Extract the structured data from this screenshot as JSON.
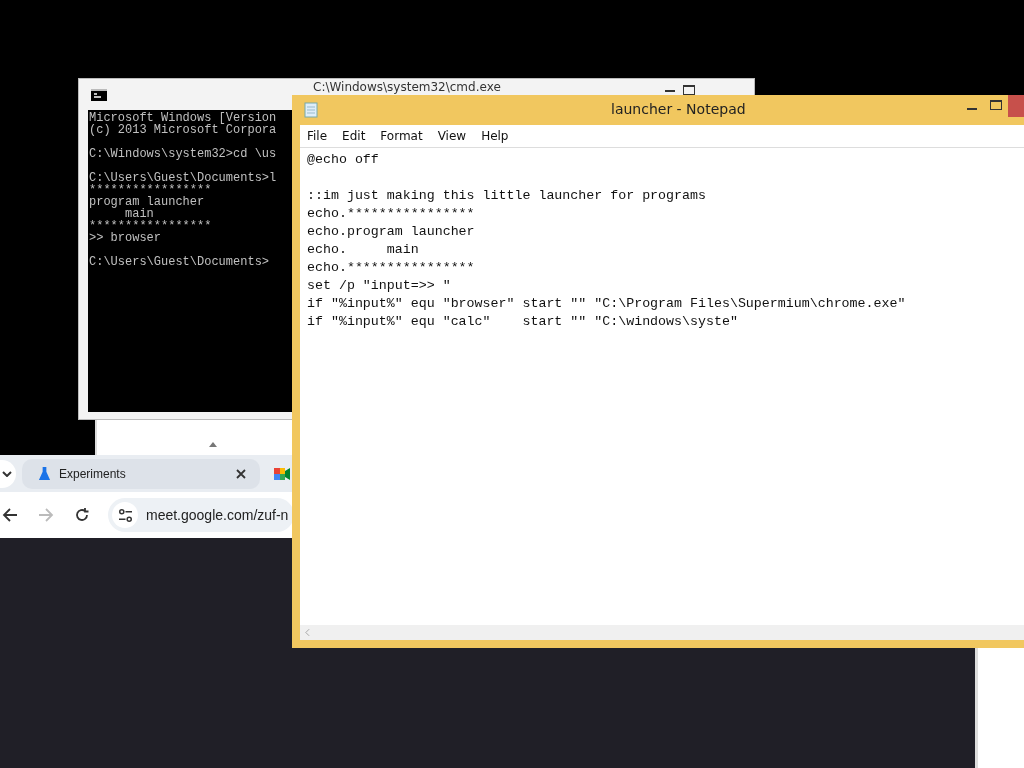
{
  "cmd_window": {
    "title": "C:\\Windows\\system32\\cmd.exe",
    "blocks": [
      [
        "Microsoft Windows [Version",
        "(c) 2013 Microsoft Corpora"
      ],
      [
        "C:\\Windows\\system32>cd \\us"
      ],
      [
        "C:\\Users\\Guest\\Documents>l",
        "*****************",
        "program launcher",
        "     main",
        "*****************",
        ">> browser"
      ],
      [
        "C:\\Users\\Guest\\Documents>"
      ]
    ]
  },
  "browser": {
    "tabs": [
      {
        "title": "Experiments"
      }
    ],
    "nav": [
      {
        "kind": "back",
        "disabled": false
      },
      {
        "kind": "forward",
        "disabled": true
      },
      {
        "kind": "reload",
        "disabled": false
      }
    ],
    "address": "meet.google.com/zuf-n"
  },
  "notepad": {
    "title": "launcher - Notepad",
    "menu": [
      "File",
      "Edit",
      "Format",
      "View",
      "Help"
    ],
    "blocks": [
      [
        "@echo off"
      ],
      [
        "::im just making this little launcher for programs",
        "echo.****************",
        "echo.program launcher",
        "echo.     main",
        "echo.****************",
        "set /p \"input=>> \"",
        "if \"%input%\" equ \"browser\" start \"\" \"C:\\Program Files\\Supermium\\chrome.exe\"",
        "if \"%input%\" equ \"calc\"    start \"\" \"C:\\windows\\syste\""
      ]
    ]
  }
}
